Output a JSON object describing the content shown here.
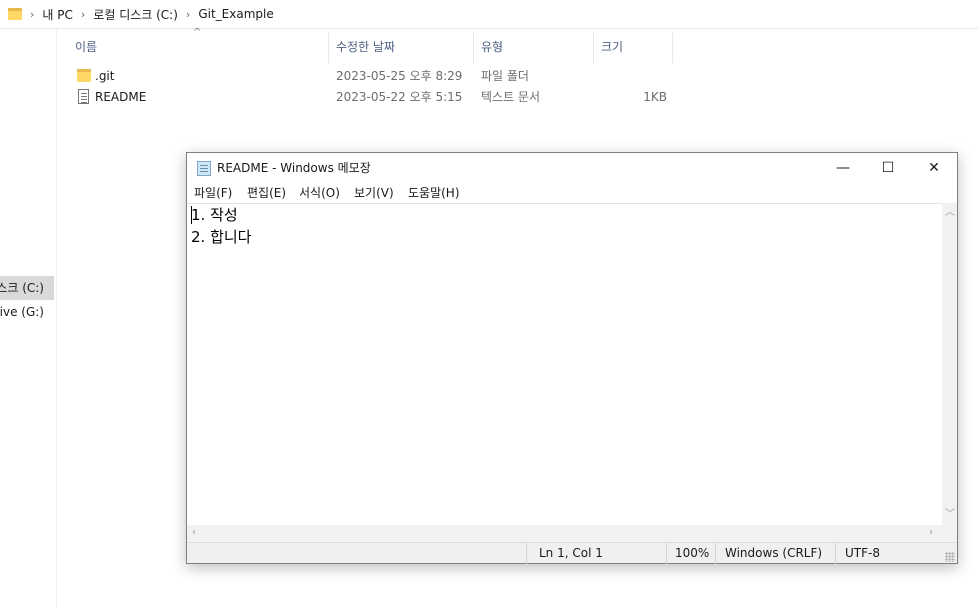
{
  "explorer": {
    "breadcrumb": [
      "내 PC",
      "로컬 디스크 (C:)",
      "Git_Example"
    ],
    "nav_items": [
      {
        "label": "로컬 디스크 (C:)",
        "selected": true
      },
      {
        "label": "Google Drive (G:)",
        "selected": false
      }
    ],
    "columns": {
      "name": "이름",
      "modified": "수정한 날짜",
      "type": "유형",
      "size": "크기"
    },
    "files": [
      {
        "name": ".git",
        "modified": "2023-05-25 오후 8:29",
        "type": "파일 폴더",
        "size": "",
        "icon": "folder-icon"
      },
      {
        "name": "README",
        "modified": "2023-05-22 오후 5:15",
        "type": "텍스트 문서",
        "size": "1KB",
        "icon": "text-document-icon"
      }
    ]
  },
  "notepad": {
    "title": "README - Windows 메모장",
    "controls": {
      "minimize": "—",
      "maximize": "☐",
      "close": "✕"
    },
    "menu": [
      "파일(F)",
      "편집(E)",
      "서식(O)",
      "보기(V)",
      "도움말(H)"
    ],
    "content": [
      "1. 작성",
      "2. 합니다"
    ],
    "status": {
      "position": "Ln 1, Col 1",
      "zoom": "100%",
      "line_ending": "Windows (CRLF)",
      "encoding": "UTF-8"
    }
  },
  "colors": {
    "selection": "#d9d9d9",
    "header_text": "#4d6082",
    "statusbar": "#f0f0f0"
  }
}
